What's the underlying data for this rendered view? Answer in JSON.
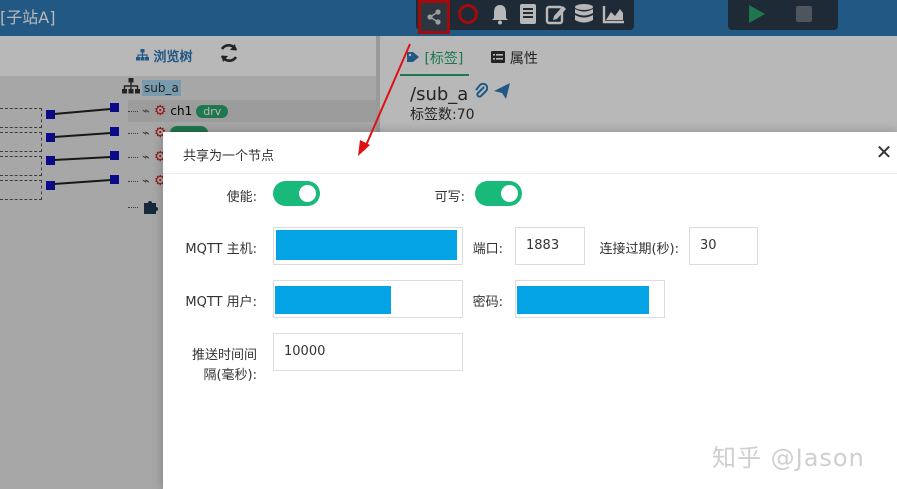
{
  "app": {
    "title": "[子站A]"
  },
  "toolbar": {
    "share_icon": "share-icon",
    "icons": [
      "bell-icon",
      "book-icon",
      "edit-icon",
      "database-icon",
      "chart-icon"
    ],
    "run_icon": "play-icon",
    "stop_icon": "stop-icon"
  },
  "tree": {
    "title": "浏览树",
    "root_label": "sub_a",
    "rows": [
      {
        "name": "ch1",
        "badge": "drv"
      }
    ]
  },
  "properties": {
    "tabs": [
      {
        "label": "[标签]",
        "active": true
      },
      {
        "label": "属性",
        "active": false
      }
    ],
    "node_path": "/sub_a",
    "tag_count": "标签数:70"
  },
  "dialog": {
    "title": "共享为一个节点",
    "close_icon": "close-icon",
    "enable_label": "使能:",
    "enable_on": true,
    "writable_label": "可写:",
    "writable_on": true,
    "mqtt_host_label": "MQTT 主机:",
    "port_label": "端口:",
    "port_value": "1883",
    "timeout_label": "连接过期(秒):",
    "timeout_value": "30",
    "mqtt_user_label": "MQTT 用户:",
    "password_label": "密码:",
    "interval_label_1": "推送时间间",
    "interval_label_2": "隔(毫秒):",
    "interval_value": "10000"
  },
  "watermark": "知乎 @Jason",
  "colors": {
    "topbar": "#2f7ab8",
    "switch_on": "#18b97a",
    "redaction": "#03a3e6",
    "highlight": "#e01010"
  }
}
